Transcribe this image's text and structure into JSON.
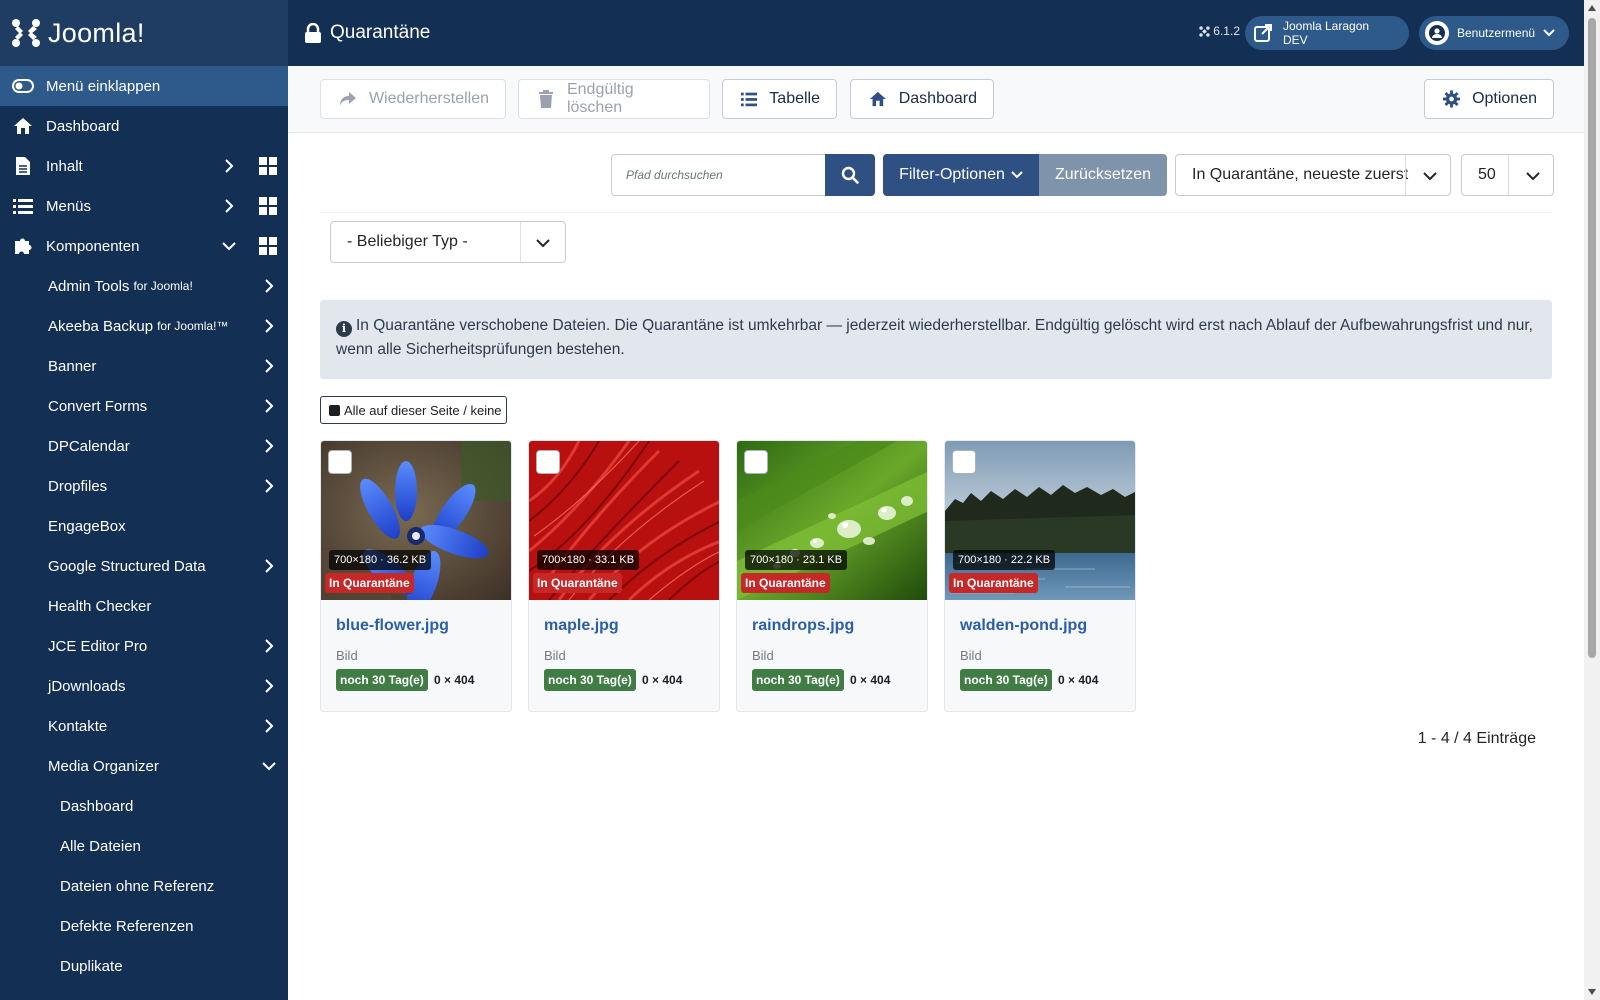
{
  "brand": {
    "name": "Joomla!"
  },
  "sidebar": {
    "toggle_label": "Menü einklappen",
    "items": [
      {
        "label": "Dashboard"
      },
      {
        "label": "Inhalt"
      },
      {
        "label": "Menüs"
      },
      {
        "label": "Komponenten"
      }
    ],
    "components": [
      {
        "label": "Admin Tools",
        "suffix": "for Joomla!"
      },
      {
        "label": "Akeeba Backup",
        "suffix": "for Joomla!™"
      },
      {
        "label": "Banner",
        "suffix": ""
      },
      {
        "label": "Convert Forms",
        "suffix": ""
      },
      {
        "label": "DPCalendar",
        "suffix": ""
      },
      {
        "label": "Dropfiles",
        "suffix": ""
      },
      {
        "label": "EngageBox",
        "suffix": ""
      },
      {
        "label": "Google Structured Data",
        "suffix": ""
      },
      {
        "label": "Health Checker",
        "suffix": ""
      },
      {
        "label": "JCE Editor Pro",
        "suffix": ""
      },
      {
        "label": "jDownloads",
        "suffix": ""
      },
      {
        "label": "Kontakte",
        "suffix": ""
      },
      {
        "label": "Media Organizer",
        "suffix": ""
      }
    ],
    "media_organizer": [
      {
        "label": "Dashboard"
      },
      {
        "label": "Alle Dateien"
      },
      {
        "label": "Dateien ohne Referenz"
      },
      {
        "label": "Defekte Referenzen"
      },
      {
        "label": "Duplikate"
      }
    ]
  },
  "header": {
    "title": "Quarantäne",
    "version": "6.1.2",
    "site_link": "Joomla Laragon DEV",
    "user_menu": "Benutzermenü"
  },
  "toolbar": {
    "restore": "Wiederherstellen",
    "delete": "Endgültig löschen",
    "table": "Tabelle",
    "dashboard": "Dashboard",
    "options": "Optionen"
  },
  "filters": {
    "search_placeholder": "Pfad durchsuchen",
    "filter_options": "Filter-Optionen",
    "reset": "Zurücksetzen",
    "sort": "In Quarantäne, neueste zuerst",
    "limit": "50",
    "type": "- Beliebiger Typ -"
  },
  "alert": {
    "text": "In Quarantäne verschobene Dateien. Die Quarantäne ist umkehrbar — jederzeit wiederherstellbar. Endgültig gelöscht wird erst nach Ablauf der Aufbewahrungsfrist und nur, wenn alle Sicherheitsprüfungen bestehen."
  },
  "select_all": "Alle auf dieser Seite / keine",
  "cards": [
    {
      "name": "blue-flower.jpg",
      "meta": "700×180 · 36.2 KB",
      "status": "In Quarantäne",
      "type": "Bild",
      "days": "noch 30 Tag(e)",
      "dims": "0 × 404"
    },
    {
      "name": "maple.jpg",
      "meta": "700×180 · 33.1 KB",
      "status": "In Quarantäne",
      "type": "Bild",
      "days": "noch 30 Tag(e)",
      "dims": "0 × 404"
    },
    {
      "name": "raindrops.jpg",
      "meta": "700×180 · 23.1 KB",
      "status": "In Quarantäne",
      "type": "Bild",
      "days": "noch 30 Tag(e)",
      "dims": "0 × 404"
    },
    {
      "name": "walden-pond.jpg",
      "meta": "700×180 · 22.2 KB",
      "status": "In Quarantäne",
      "type": "Bild",
      "days": "noch 30 Tag(e)",
      "dims": "0 × 404"
    }
  ],
  "pagination": "1 - 4 / 4 Einträge",
  "colors": {
    "sidebar": "#132f53",
    "accent": "#2e5082",
    "danger": "#c52827",
    "success": "#3f7d45",
    "link": "#2a5ea8"
  }
}
